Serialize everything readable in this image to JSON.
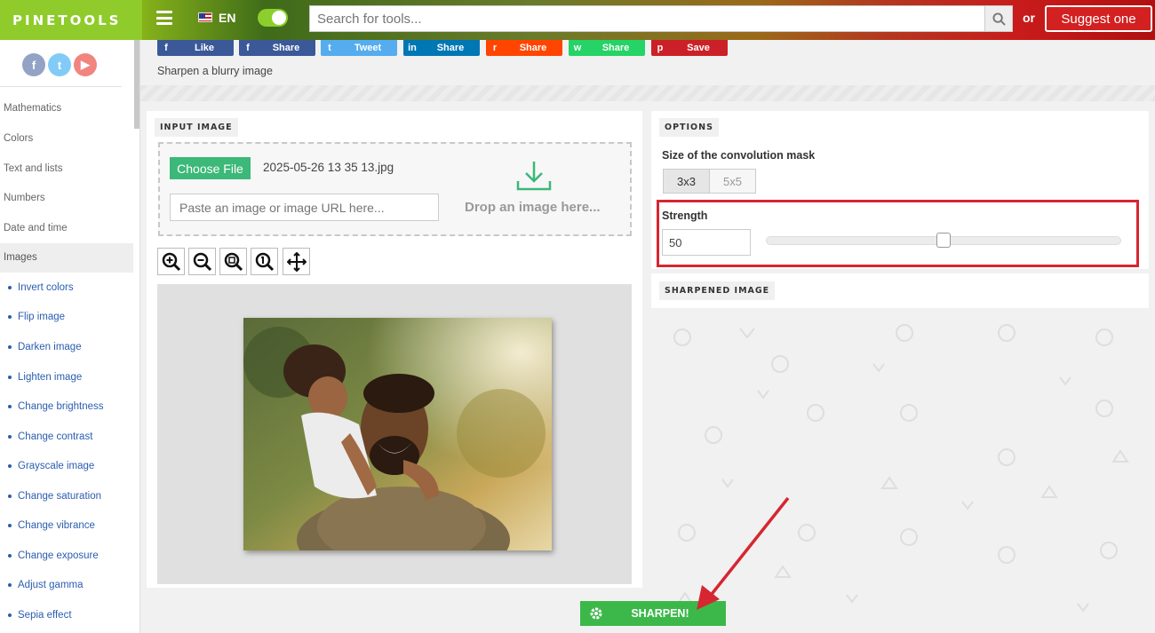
{
  "header": {
    "logo": "PINETOOLS",
    "language": "EN",
    "search_placeholder": "Search for tools...",
    "or": "or",
    "suggest": "Suggest one"
  },
  "sidebar": {
    "socials": [
      "f",
      "t",
      "▶"
    ],
    "categories": [
      "Mathematics",
      "Colors",
      "Text and lists",
      "Numbers",
      "Date and time",
      "Images"
    ],
    "active_category": "Images",
    "tools": [
      "Invert colors",
      "Flip image",
      "Darken image",
      "Lighten image",
      "Change brightness",
      "Change contrast",
      "Grayscale image",
      "Change saturation",
      "Change vibrance",
      "Change exposure",
      "Adjust gamma",
      "Sepia effect"
    ]
  },
  "share": [
    {
      "label": "Like",
      "icon": "f",
      "color": "#3b5998"
    },
    {
      "label": "Share",
      "icon": "f",
      "color": "#3b5998"
    },
    {
      "label": "Tweet",
      "icon": "t",
      "color": "#55acee"
    },
    {
      "label": "Share",
      "icon": "in",
      "color": "#0077b5"
    },
    {
      "label": "Share",
      "icon": "r",
      "color": "#ff4500"
    },
    {
      "label": "Share",
      "icon": "w",
      "color": "#25d366"
    },
    {
      "label": "Save",
      "icon": "p",
      "color": "#cb2027"
    }
  ],
  "page": {
    "subtitle": "Sharpen a blurry image"
  },
  "input": {
    "title": "INPUT IMAGE",
    "choose_file": "Choose File",
    "file_name": "2025-05-26 13 35 13.jpg",
    "url_placeholder": "Paste an image or image URL here...",
    "drop_text": "Drop an image here..."
  },
  "options": {
    "title": "OPTIONS",
    "mask_label": "Size of the convolution mask",
    "mask_options": [
      "3x3",
      "5x5"
    ],
    "mask_selected": "3x3",
    "strength_label": "Strength",
    "strength_value": "50",
    "strength_fraction": 0.5
  },
  "output": {
    "title": "SHARPENED IMAGE"
  },
  "action": {
    "sharpen": "SHARPEN!"
  },
  "colors": {
    "accent_green": "#3cb878",
    "highlight_red": "#d62631",
    "brand_green": "#8fcb2a"
  }
}
